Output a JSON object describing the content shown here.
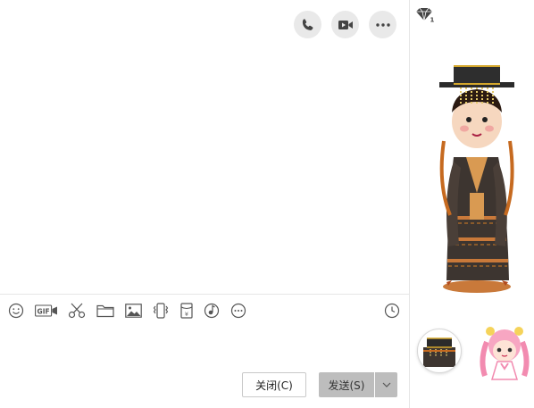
{
  "header": {
    "call_icon": "phone-icon",
    "video_icon": "video-camera-icon",
    "more_icon": "more-horizontal-icon"
  },
  "toolbar": {
    "icons": [
      "emoji-icon",
      "gif-icon",
      "scissors-icon",
      "folder-icon",
      "image-icon",
      "shake-icon",
      "red-packet-icon",
      "music-icon",
      "more-circle-icon",
      "history-clock-icon"
    ],
    "gif_label": "GIF"
  },
  "input": {
    "value": ""
  },
  "actions": {
    "close_label": "关闭(C)",
    "send_label": "发送(S)"
  },
  "side": {
    "vip_icon": "diamond-icon"
  },
  "colors": {
    "panel_bg": "#ffffff",
    "button_gray": "#bdbdbd",
    "circle_gray": "#e9e9e9",
    "icon_gray": "#555555"
  }
}
